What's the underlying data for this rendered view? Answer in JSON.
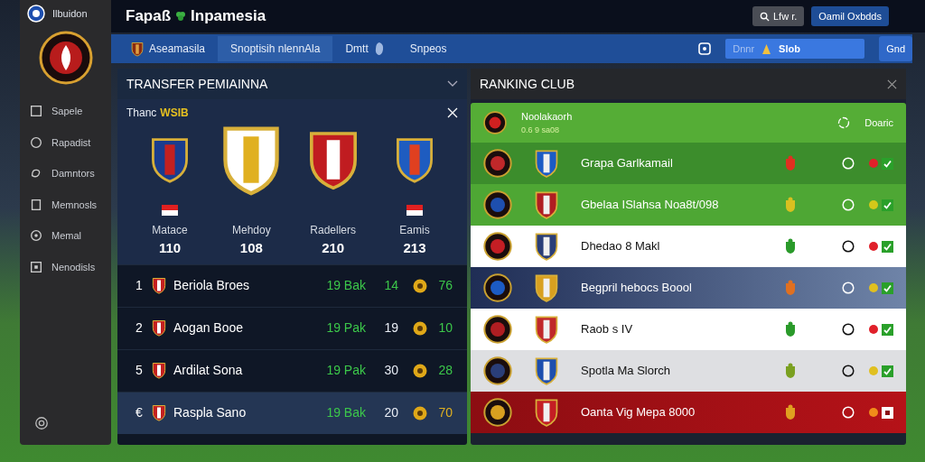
{
  "sidebar": {
    "brand": "Ilbuidon",
    "items": [
      {
        "label": "Sapele"
      },
      {
        "label": "Rapadist"
      },
      {
        "label": "Damntors"
      },
      {
        "label": "Memnosls"
      },
      {
        "label": "Memal"
      },
      {
        "label": "Nenodisls"
      }
    ]
  },
  "topbar": {
    "title_left": "Fapaß",
    "title_right": "Inpamesia",
    "search_button": "Lfw r.",
    "account_button": "Oamil Oxbdds"
  },
  "nav": {
    "tabs": [
      {
        "label": "Aseamasila",
        "selected": false
      },
      {
        "label": "Snoptisih nlennAla",
        "selected": true
      },
      {
        "label": "Dmtt",
        "selected": false
      },
      {
        "label": "Snpeos",
        "selected": false
      }
    ],
    "search": {
      "prefix": "Dnnr",
      "value": "Slob"
    },
    "go_button": "Gnd"
  },
  "transfer": {
    "title": "TRANSFER PEMIAINNA",
    "card": {
      "title": "Thanc",
      "highlight": "WSIB",
      "clubs": [
        {
          "name": "Matace",
          "value": "110",
          "badge": true
        },
        {
          "name": "Mehdoy",
          "value": "108",
          "badge": false
        },
        {
          "name": "Radellers",
          "value": "210",
          "badge": false
        },
        {
          "name": "Eamis",
          "value": "213",
          "badge": true
        }
      ]
    },
    "rows": [
      {
        "rank": "1",
        "name": "Beriola Broes",
        "record": "19 Bak",
        "stat": {
          "text": "14",
          "color": "#3cc84a"
        },
        "score": {
          "text": "76",
          "color": "#3cc84a"
        },
        "selected": false
      },
      {
        "rank": "2",
        "name": "Aogan Booe",
        "record": "19 Pak",
        "stat": {
          "text": "19",
          "color": "#e8edf5"
        },
        "score": {
          "text": "10",
          "color": "#3cc84a"
        },
        "selected": false
      },
      {
        "rank": "5",
        "name": "Ardilat Sona",
        "record": "19 Pak",
        "stat": {
          "text": "30",
          "color": "#e8edf5"
        },
        "score": {
          "text": "28",
          "color": "#3cc84a"
        },
        "selected": false
      },
      {
        "rank": "€",
        "name": "Raspla Sano",
        "record": "19 Bak",
        "stat": {
          "text": "20",
          "color": "#e8edf5"
        },
        "score": {
          "text": "70",
          "color": "#e0b020"
        },
        "selected": true
      }
    ]
  },
  "ranking": {
    "title": "RANKING CLUB",
    "header": {
      "name": "Noolakaorh",
      "sub": "0.6 9 sa08",
      "action": "Doaric"
    },
    "rows": [
      {
        "kind": "green-dark",
        "name": "Grapa Garlkamail",
        "color": "#e0202a",
        "checked": true
      },
      {
        "kind": "green",
        "name": "Gbelaa ISlahsa Noa8t/098",
        "color": "#d4c81a",
        "checked": true
      },
      {
        "kind": "light",
        "name": "Dhedao 8 Makl",
        "color": "#e0202a",
        "checked": true
      },
      {
        "kind": "navy",
        "name": "Begpril hebocs Boool",
        "color": "#e0c020",
        "checked": true
      },
      {
        "kind": "light",
        "name": "Raob s IV",
        "color": "#e0202a",
        "checked": true
      },
      {
        "kind": "gray",
        "name": "Spotla Ma Slorch",
        "color": "#e0c020",
        "checked": true
      },
      {
        "kind": "red",
        "name": "Oanta Vig Mepa 8000",
        "color": "#f08c1a",
        "checked": false
      }
    ]
  }
}
